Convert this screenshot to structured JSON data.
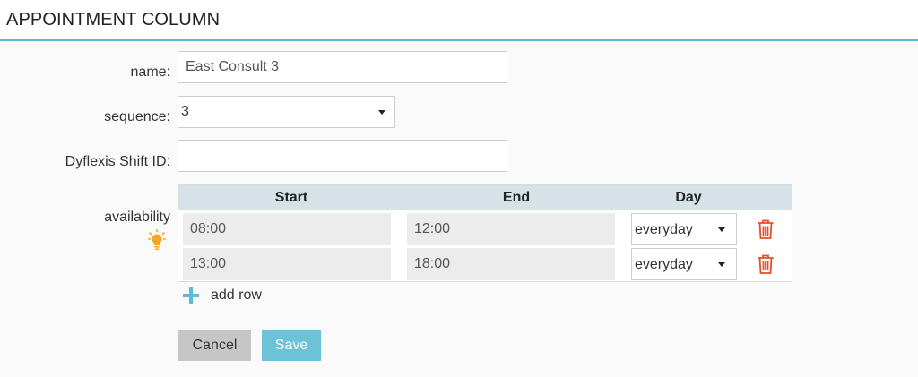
{
  "header": {
    "title": "APPOINTMENT COLUMN"
  },
  "form": {
    "name_label": "name:",
    "name_value": "East Consult 3",
    "sequence_label": "sequence:",
    "sequence_value": "3",
    "shift_label": "Dyflexis Shift ID:",
    "shift_value": "",
    "availability_label": "availability"
  },
  "availability": {
    "columns": [
      "Start",
      "End",
      "Day"
    ],
    "rows": [
      {
        "start": "08:00",
        "end": "12:00",
        "day": "everyday"
      },
      {
        "start": "13:00",
        "end": "18:00",
        "day": "everyday"
      }
    ],
    "add_row_label": "add row"
  },
  "buttons": {
    "cancel": "Cancel",
    "save": "Save"
  },
  "icons": {
    "bulb": "lightbulb-icon",
    "trash": "trash-icon",
    "plus": "plus-icon",
    "caret": "caret-down-icon"
  },
  "colors": {
    "accent": "#5bbdd3",
    "save": "#6cc2d6",
    "cancel": "#c6c6c6",
    "trash": "#e0502a",
    "bulb": "#f5a623",
    "table_header": "#d6e2e8"
  }
}
